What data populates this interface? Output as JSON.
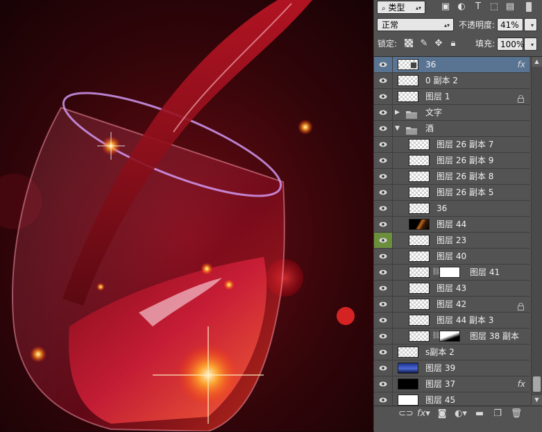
{
  "panel": {
    "filter_kind": "类型",
    "blend_mode": "正常",
    "opacity_label": "不透明度:",
    "opacity_value": "41%",
    "lock_label": "锁定:",
    "fill_label": "填充:",
    "fill_value": "100%"
  },
  "layers": [
    {
      "name": "36",
      "indent": 0,
      "thumb": "smart",
      "fx": true,
      "selected": true
    },
    {
      "name": "0 副本 2",
      "indent": 0,
      "thumb": "checker"
    },
    {
      "name": "图层 1",
      "indent": 0,
      "thumb": "checker",
      "locked": true
    },
    {
      "name": "文字",
      "indent": 0,
      "group": "closed"
    },
    {
      "name": "酒",
      "indent": 0,
      "group": "open"
    },
    {
      "name": "图层 26 副本 7",
      "indent": 1,
      "thumb": "checker"
    },
    {
      "name": "图层 26 副本 9",
      "indent": 1,
      "thumb": "checker"
    },
    {
      "name": "图层 26 副本 8",
      "indent": 1,
      "thumb": "checker"
    },
    {
      "name": "图层 26 副本 5",
      "indent": 1,
      "thumb": "checker"
    },
    {
      "name": "36",
      "indent": 1,
      "thumb": "checker"
    },
    {
      "name": "图层 44",
      "indent": 1,
      "thumb": "dark"
    },
    {
      "name": "图层 23",
      "indent": 1,
      "thumb": "checker",
      "eye_highlight": true
    },
    {
      "name": "图层 40",
      "indent": 1,
      "thumb": "checker"
    },
    {
      "name": "图层 41",
      "indent": 1,
      "thumb": "checker",
      "mask": "white"
    },
    {
      "name": "图层 43",
      "indent": 1,
      "thumb": "checker"
    },
    {
      "name": "图层 42",
      "indent": 1,
      "thumb": "checker",
      "locked": true
    },
    {
      "name": "图层 44 副本 3",
      "indent": 1,
      "thumb": "checker"
    },
    {
      "name": "图层 38 副本",
      "indent": 1,
      "thumb": "checker",
      "mask": "black"
    },
    {
      "name": "s副本 2",
      "indent": 0,
      "thumb": "checker"
    },
    {
      "name": "图层 39",
      "indent": 0,
      "thumb": "img39"
    },
    {
      "name": "图层 37",
      "indent": 0,
      "thumb": "black",
      "fx": true
    },
    {
      "name": "图层 45",
      "indent": 0,
      "thumb": "white"
    }
  ],
  "colors": {
    "panel_bg": "#535353",
    "selected_row": "#597493",
    "eye_highlight": "#6b8f3d"
  },
  "icons": {
    "filter_icons": [
      "image-filter-icon",
      "adjustment-filter-icon",
      "type-filter-icon",
      "shape-filter-icon",
      "smart-object-filter-icon"
    ],
    "lock_icons": [
      "lock-transparent-icon",
      "lock-paint-icon",
      "lock-position-icon",
      "lock-all-icon"
    ],
    "bottom_icons": [
      "link-layers-icon",
      "fx-icon",
      "add-mask-icon",
      "adjustment-layer-icon",
      "new-group-icon",
      "new-layer-icon",
      "delete-layer-icon"
    ],
    "fx_label": "fx"
  }
}
